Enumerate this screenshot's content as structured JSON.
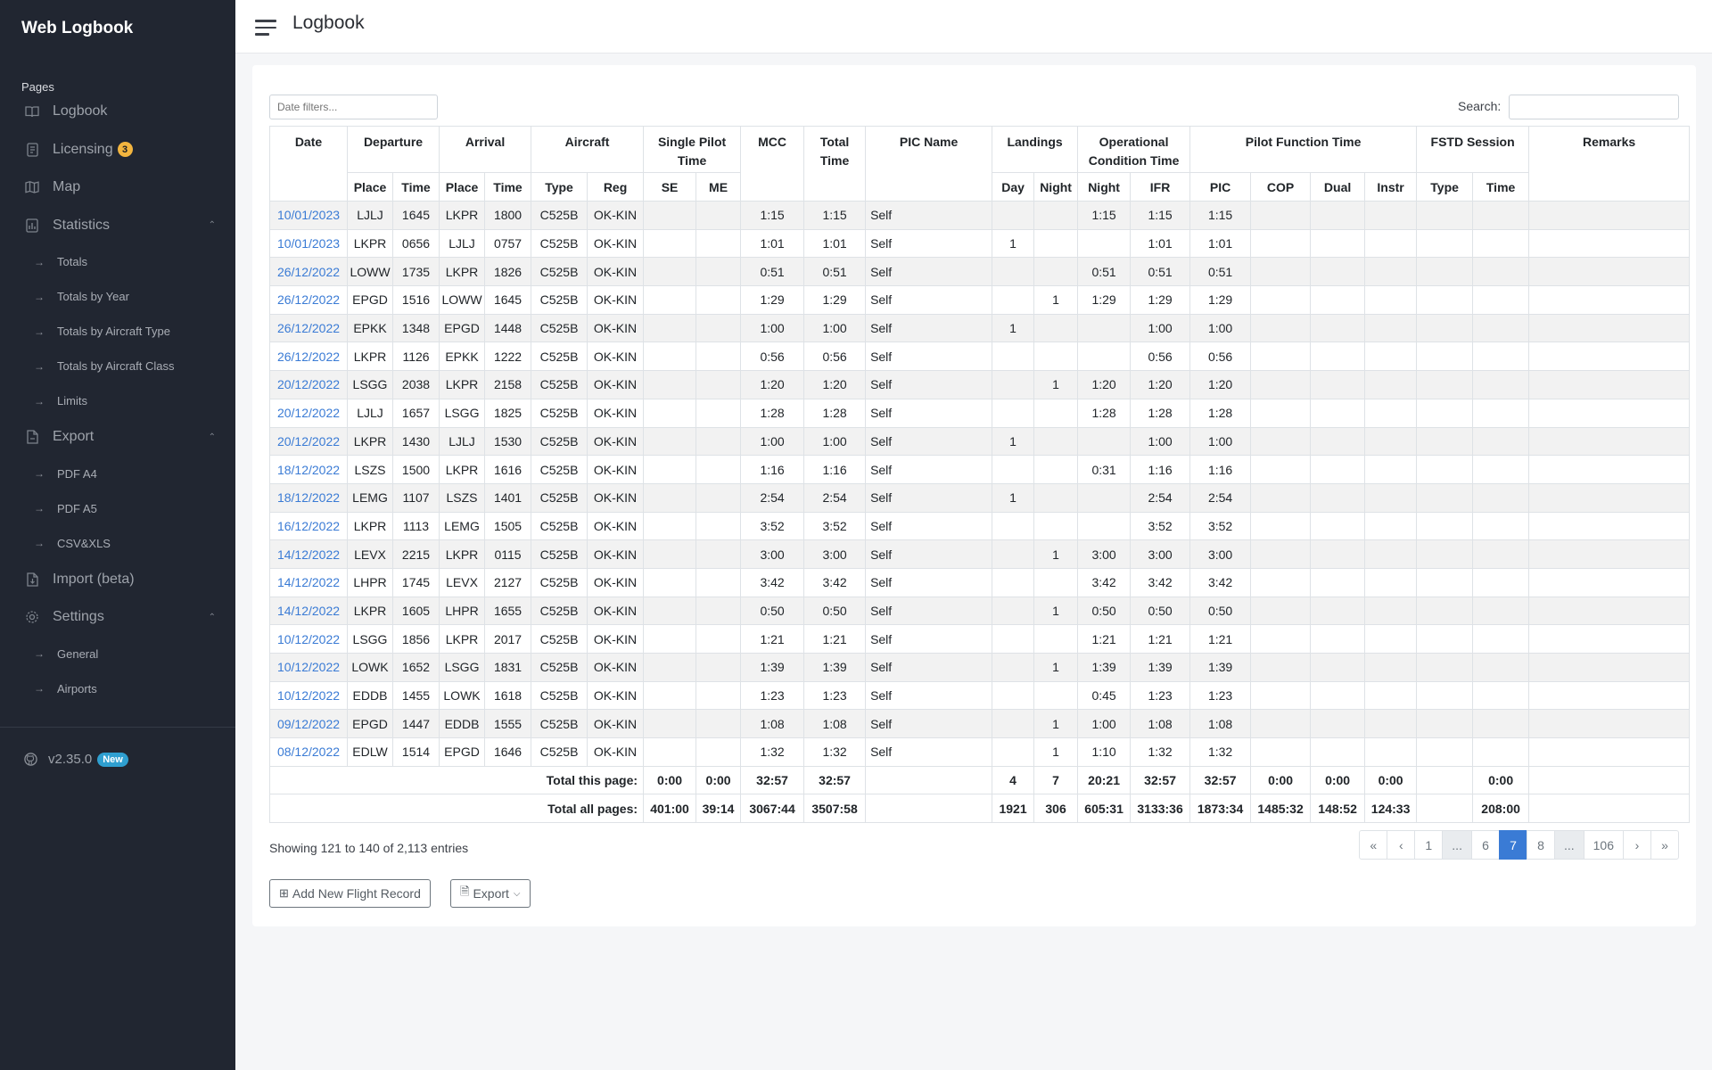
{
  "sidebar": {
    "brand": "Web Logbook",
    "section_title": "Pages",
    "items": {
      "logbook": "Logbook",
      "licensing": "Licensing",
      "licensing_badge": "3",
      "map": "Map",
      "statistics": "Statistics",
      "export": "Export",
      "import": "Import (beta)",
      "settings": "Settings"
    },
    "statistics_sub": [
      "Totals",
      "Totals by Year",
      "Totals by Aircraft Type",
      "Totals by Aircraft Class",
      "Limits"
    ],
    "export_sub": [
      "PDF A4",
      "PDF A5",
      "CSV&XLS"
    ],
    "settings_sub": [
      "General",
      "Airports"
    ],
    "version": "v2.35.0",
    "version_badge": "New"
  },
  "header": {
    "title": "Logbook"
  },
  "filters": {
    "date_placeholder": "Date filters...",
    "search_label": "Search:"
  },
  "table": {
    "headers": {
      "date": "Date",
      "departure": "Departure",
      "arrival": "Arrival",
      "aircraft": "Aircraft",
      "single_pilot_time": "Single Pilot Time",
      "mcc": "MCC",
      "total_time": "Total Time",
      "pic_name": "PIC Name",
      "landings": "Landings",
      "operational_condition_time": "Operational Condition Time",
      "pilot_function_time": "Pilot Function Time",
      "fstd_session": "FSTD Session",
      "remarks": "Remarks"
    },
    "subheaders": {
      "dep_place": "Place",
      "dep_time": "Time",
      "arr_place": "Place",
      "arr_time": "Time",
      "type": "Type",
      "reg": "Reg",
      "se": "SE",
      "me": "ME",
      "day": "Day",
      "night": "Night",
      "oc_night": "Night",
      "ifr": "IFR",
      "pic": "PIC",
      "cop": "COP",
      "dual": "Dual",
      "instr": "Instr",
      "fstd_type": "Type",
      "fstd_time": "Time"
    },
    "rows": [
      [
        "10/01/2023",
        "LJLJ",
        "1645",
        "LKPR",
        "1800",
        "C525B",
        "OK-KIN",
        "",
        "",
        "1:15",
        "1:15",
        "Self",
        "",
        "",
        "1:15",
        "1:15",
        "1:15",
        "",
        "",
        "",
        "",
        "",
        ""
      ],
      [
        "10/01/2023",
        "LKPR",
        "0656",
        "LJLJ",
        "0757",
        "C525B",
        "OK-KIN",
        "",
        "",
        "1:01",
        "1:01",
        "Self",
        "1",
        "",
        "",
        "1:01",
        "1:01",
        "",
        "",
        "",
        "",
        "",
        ""
      ],
      [
        "26/12/2022",
        "LOWW",
        "1735",
        "LKPR",
        "1826",
        "C525B",
        "OK-KIN",
        "",
        "",
        "0:51",
        "0:51",
        "Self",
        "",
        "",
        "0:51",
        "0:51",
        "0:51",
        "",
        "",
        "",
        "",
        "",
        ""
      ],
      [
        "26/12/2022",
        "EPGD",
        "1516",
        "LOWW",
        "1645",
        "C525B",
        "OK-KIN",
        "",
        "",
        "1:29",
        "1:29",
        "Self",
        "",
        "1",
        "1:29",
        "1:29",
        "1:29",
        "",
        "",
        "",
        "",
        "",
        ""
      ],
      [
        "26/12/2022",
        "EPKK",
        "1348",
        "EPGD",
        "1448",
        "C525B",
        "OK-KIN",
        "",
        "",
        "1:00",
        "1:00",
        "Self",
        "1",
        "",
        "",
        "1:00",
        "1:00",
        "",
        "",
        "",
        "",
        "",
        ""
      ],
      [
        "26/12/2022",
        "LKPR",
        "1126",
        "EPKK",
        "1222",
        "C525B",
        "OK-KIN",
        "",
        "",
        "0:56",
        "0:56",
        "Self",
        "",
        "",
        "",
        "0:56",
        "0:56",
        "",
        "",
        "",
        "",
        "",
        ""
      ],
      [
        "20/12/2022",
        "LSGG",
        "2038",
        "LKPR",
        "2158",
        "C525B",
        "OK-KIN",
        "",
        "",
        "1:20",
        "1:20",
        "Self",
        "",
        "1",
        "1:20",
        "1:20",
        "1:20",
        "",
        "",
        "",
        "",
        "",
        ""
      ],
      [
        "20/12/2022",
        "LJLJ",
        "1657",
        "LSGG",
        "1825",
        "C525B",
        "OK-KIN",
        "",
        "",
        "1:28",
        "1:28",
        "Self",
        "",
        "",
        "1:28",
        "1:28",
        "1:28",
        "",
        "",
        "",
        "",
        "",
        ""
      ],
      [
        "20/12/2022",
        "LKPR",
        "1430",
        "LJLJ",
        "1530",
        "C525B",
        "OK-KIN",
        "",
        "",
        "1:00",
        "1:00",
        "Self",
        "1",
        "",
        "",
        "1:00",
        "1:00",
        "",
        "",
        "",
        "",
        "",
        ""
      ],
      [
        "18/12/2022",
        "LSZS",
        "1500",
        "LKPR",
        "1616",
        "C525B",
        "OK-KIN",
        "",
        "",
        "1:16",
        "1:16",
        "Self",
        "",
        "",
        "0:31",
        "1:16",
        "1:16",
        "",
        "",
        "",
        "",
        "",
        ""
      ],
      [
        "18/12/2022",
        "LEMG",
        "1107",
        "LSZS",
        "1401",
        "C525B",
        "OK-KIN",
        "",
        "",
        "2:54",
        "2:54",
        "Self",
        "1",
        "",
        "",
        "2:54",
        "2:54",
        "",
        "",
        "",
        "",
        "",
        ""
      ],
      [
        "16/12/2022",
        "LKPR",
        "1113",
        "LEMG",
        "1505",
        "C525B",
        "OK-KIN",
        "",
        "",
        "3:52",
        "3:52",
        "Self",
        "",
        "",
        "",
        "3:52",
        "3:52",
        "",
        "",
        "",
        "",
        "",
        ""
      ],
      [
        "14/12/2022",
        "LEVX",
        "2215",
        "LKPR",
        "0115",
        "C525B",
        "OK-KIN",
        "",
        "",
        "3:00",
        "3:00",
        "Self",
        "",
        "1",
        "3:00",
        "3:00",
        "3:00",
        "",
        "",
        "",
        "",
        "",
        ""
      ],
      [
        "14/12/2022",
        "LHPR",
        "1745",
        "LEVX",
        "2127",
        "C525B",
        "OK-KIN",
        "",
        "",
        "3:42",
        "3:42",
        "Self",
        "",
        "",
        "3:42",
        "3:42",
        "3:42",
        "",
        "",
        "",
        "",
        "",
        ""
      ],
      [
        "14/12/2022",
        "LKPR",
        "1605",
        "LHPR",
        "1655",
        "C525B",
        "OK-KIN",
        "",
        "",
        "0:50",
        "0:50",
        "Self",
        "",
        "1",
        "0:50",
        "0:50",
        "0:50",
        "",
        "",
        "",
        "",
        "",
        ""
      ],
      [
        "10/12/2022",
        "LSGG",
        "1856",
        "LKPR",
        "2017",
        "C525B",
        "OK-KIN",
        "",
        "",
        "1:21",
        "1:21",
        "Self",
        "",
        "",
        "1:21",
        "1:21",
        "1:21",
        "",
        "",
        "",
        "",
        "",
        ""
      ],
      [
        "10/12/2022",
        "LOWK",
        "1652",
        "LSGG",
        "1831",
        "C525B",
        "OK-KIN",
        "",
        "",
        "1:39",
        "1:39",
        "Self",
        "",
        "1",
        "1:39",
        "1:39",
        "1:39",
        "",
        "",
        "",
        "",
        "",
        ""
      ],
      [
        "10/12/2022",
        "EDDB",
        "1455",
        "LOWK",
        "1618",
        "C525B",
        "OK-KIN",
        "",
        "",
        "1:23",
        "1:23",
        "Self",
        "",
        "",
        "0:45",
        "1:23",
        "1:23",
        "",
        "",
        "",
        "",
        "",
        ""
      ],
      [
        "09/12/2022",
        "EPGD",
        "1447",
        "EDDB",
        "1555",
        "C525B",
        "OK-KIN",
        "",
        "",
        "1:08",
        "1:08",
        "Self",
        "",
        "1",
        "1:00",
        "1:08",
        "1:08",
        "",
        "",
        "",
        "",
        "",
        ""
      ],
      [
        "08/12/2022",
        "EDLW",
        "1514",
        "EPGD",
        "1646",
        "C525B",
        "OK-KIN",
        "",
        "",
        "1:32",
        "1:32",
        "Self",
        "",
        "1",
        "1:10",
        "1:32",
        "1:32",
        "",
        "",
        "",
        "",
        "",
        ""
      ]
    ],
    "totals": [
      {
        "label": "Total this page:",
        "values": [
          "0:00",
          "0:00",
          "32:57",
          "32:57",
          "",
          "4",
          "7",
          "20:21",
          "32:57",
          "32:57",
          "0:00",
          "0:00",
          "0:00",
          "",
          "0:00",
          ""
        ]
      },
      {
        "label": "Total all pages:",
        "values": [
          "401:00",
          "39:14",
          "3067:44",
          "3507:58",
          "",
          "1921",
          "306",
          "605:31",
          "3133:36",
          "1873:34",
          "1485:32",
          "148:52",
          "124:33",
          "",
          "208:00",
          ""
        ]
      }
    ]
  },
  "showing": "Showing 121 to 140 of 2,113 entries",
  "pagination": [
    "«",
    "‹",
    "1",
    "...",
    "6",
    "7",
    "8",
    "...",
    "106",
    "›",
    "»"
  ],
  "pagination_active": "7",
  "buttons": {
    "add": "Add New Flight Record",
    "export": "Export"
  },
  "colors": {
    "sidebar_bg": "#212631",
    "accent": "#3a7bd5",
    "badge_warning": "#f3b53f",
    "badge_info": "#2f9fd0"
  }
}
